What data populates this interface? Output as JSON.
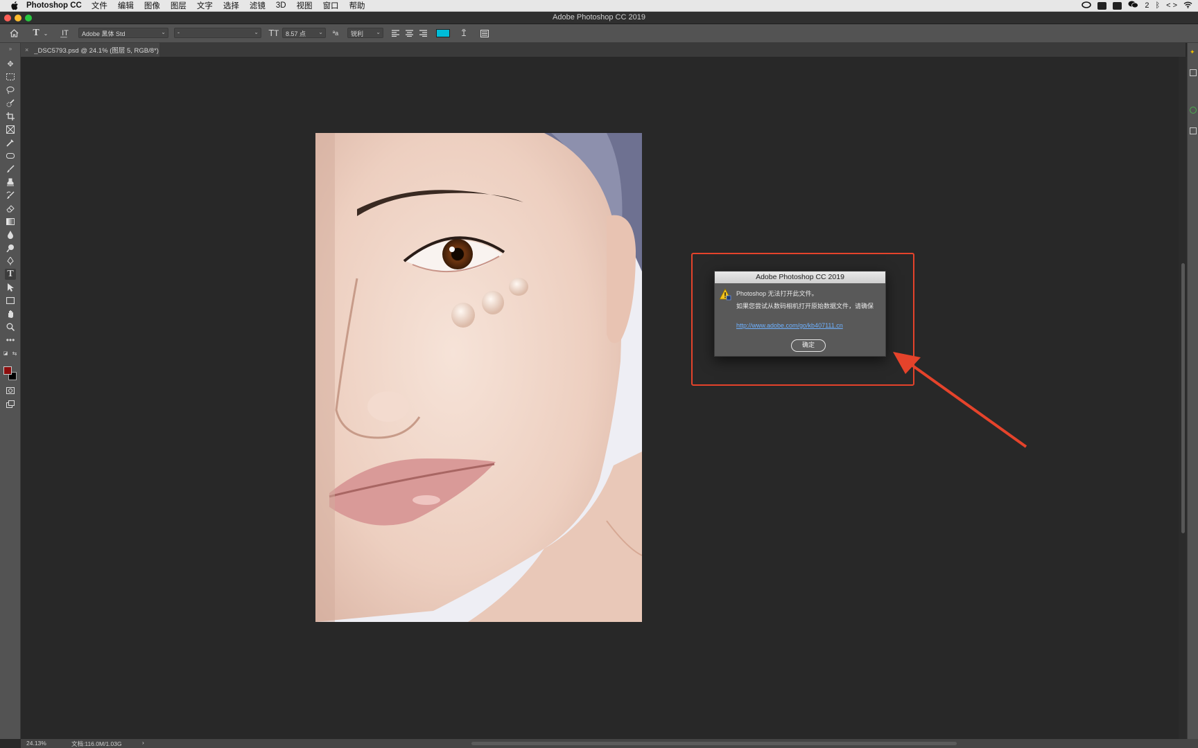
{
  "menubar": {
    "app_name": "Photoshop CC",
    "items": [
      "文件",
      "编辑",
      "图像",
      "图层",
      "文字",
      "选择",
      "滤镜",
      "3D",
      "视图",
      "窗口",
      "帮助"
    ],
    "notification_count": "2"
  },
  "window": {
    "title": "Adobe Photoshop CC 2019"
  },
  "options_bar": {
    "font_family": "Adobe 黑体 Std",
    "font_style": "-",
    "font_size": "8.57 点",
    "antialias": "锐利",
    "text_color": "#00bcd8"
  },
  "document_tab": {
    "label": "_DSC5793.psd @ 24.1% (图层 5, RGB/8*)"
  },
  "toolbar": {
    "foreground_color": "#8b0d0d",
    "background_color": "#000000"
  },
  "status_bar": {
    "zoom": "24.13%",
    "doc_info": "文档:116.0M/1.03G",
    "arrow": "›"
  },
  "dialog": {
    "title": "Adobe Photoshop CC 2019",
    "message_line1": "Photoshop 无法打开此文件。",
    "message_line2": "如果您尝试从数码相机打开原始数据文件，请确保",
    "link": "http://www.adobe.com/go/kb407111.cn",
    "ok_label": "确定"
  },
  "annotation": {
    "color": "#e5432b"
  }
}
